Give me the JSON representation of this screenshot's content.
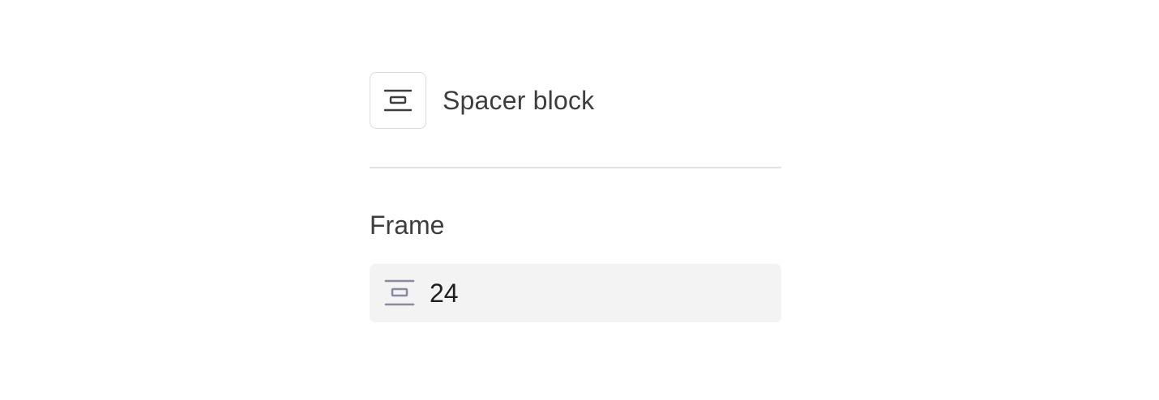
{
  "block": {
    "icon": "spacer-icon",
    "title": "Spacer block"
  },
  "frame": {
    "label": "Frame",
    "icon": "spacer-height-icon",
    "value": "24"
  },
  "colors": {
    "title_text": "#3d3d3d",
    "field_background": "#f3f3f3",
    "field_icon": "#8a8aa0",
    "divider": "#e2e2e2"
  }
}
